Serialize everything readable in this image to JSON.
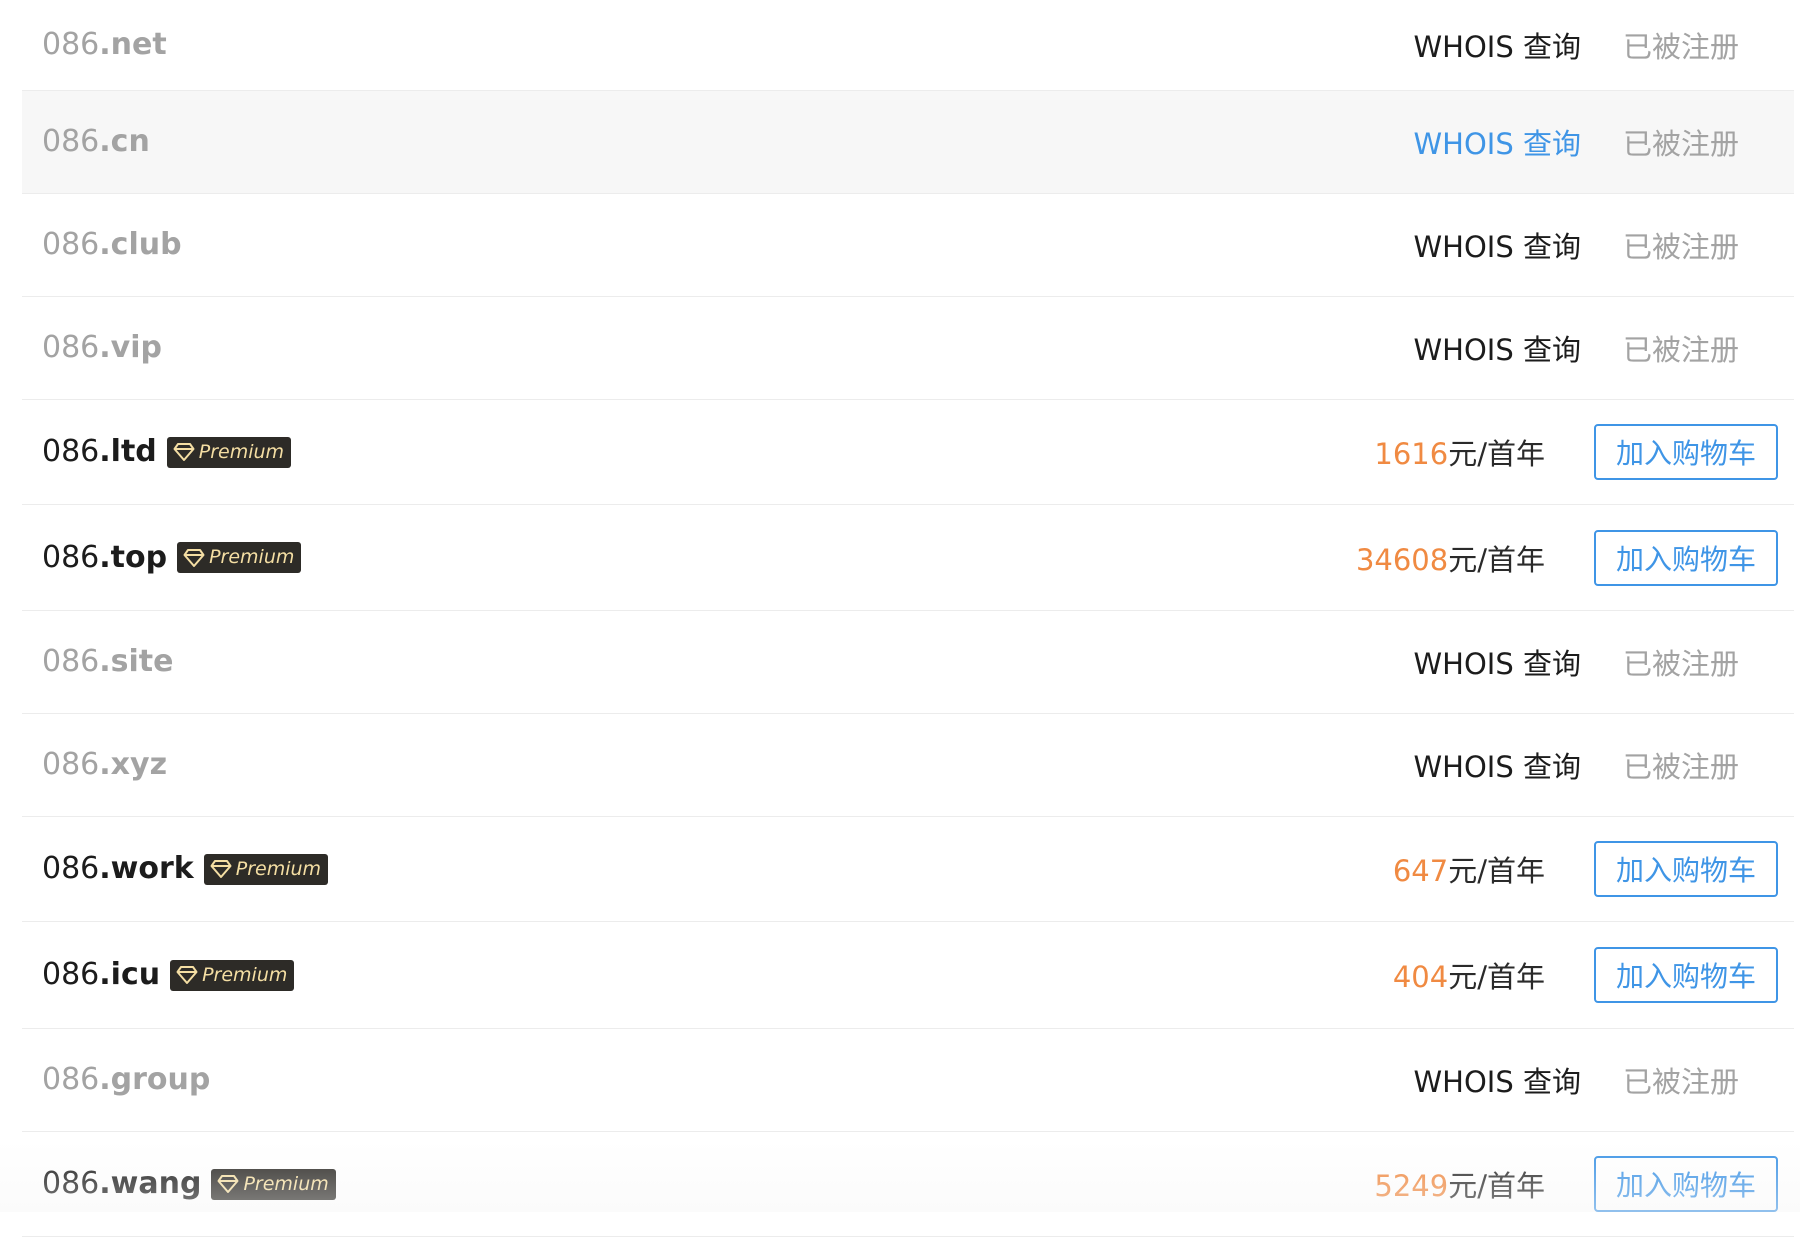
{
  "prefix": "086",
  "labels": {
    "whois": "WHOIS 查询",
    "taken": "已被注册",
    "premium": "Premium",
    "per_year": "元/首年",
    "add_to_cart": "加入购物车"
  },
  "colors": {
    "price": "#f08a42",
    "accent": "#3f95e6",
    "muted": "#a3a3a3",
    "badge_bg": "#2d2b27",
    "badge_text": "#f4dea3"
  },
  "rows": [
    {
      "tld": ".net",
      "status": "taken"
    },
    {
      "tld": ".cn",
      "status": "taken",
      "whois_highlighted": true
    },
    {
      "tld": ".club",
      "status": "taken"
    },
    {
      "tld": ".vip",
      "status": "taken"
    },
    {
      "tld": ".ltd",
      "status": "available",
      "premium": true,
      "price": "1616"
    },
    {
      "tld": ".top",
      "status": "available",
      "premium": true,
      "price": "34608"
    },
    {
      "tld": ".site",
      "status": "taken"
    },
    {
      "tld": ".xyz",
      "status": "taken"
    },
    {
      "tld": ".work",
      "status": "available",
      "premium": true,
      "price": "647"
    },
    {
      "tld": ".icu",
      "status": "available",
      "premium": true,
      "price": "404"
    },
    {
      "tld": ".group",
      "status": "taken"
    },
    {
      "tld": ".wang",
      "status": "available",
      "premium": true,
      "price": "5249"
    }
  ]
}
